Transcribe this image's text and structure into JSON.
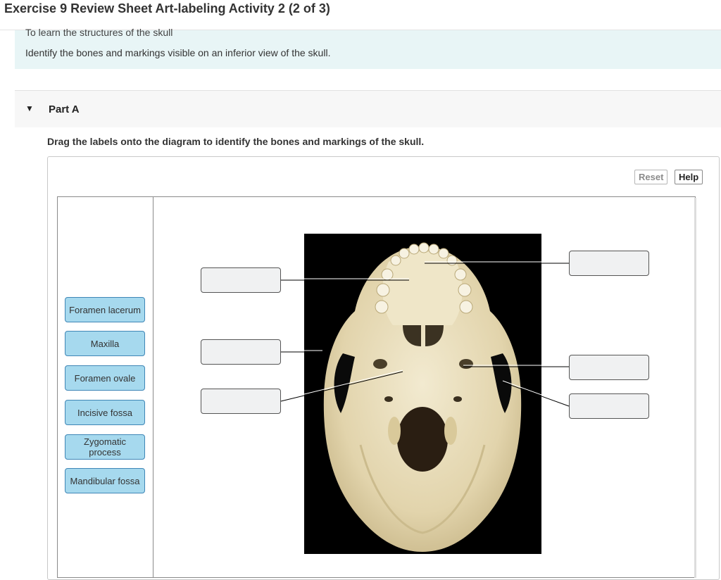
{
  "page": {
    "title": "Exercise 9 Review Sheet Art-labeling Activity 2 (2 of 3)"
  },
  "intro": {
    "objective": "To learn the structures of the skull",
    "text": "Identify the bones and markings visible on an inferior view of the skull."
  },
  "part": {
    "caret": "▼",
    "label": "Part A"
  },
  "instructions": "Drag the labels onto the diagram to identify the bones and markings of the skull.",
  "controls": {
    "reset": "Reset",
    "help": "Help"
  },
  "labels": [
    "Foramen lacerum",
    "Maxilla",
    "Foramen ovale",
    "Incisive fossa",
    "Zygomatic process",
    "Mandibular fossa"
  ],
  "colors": {
    "chip_fill": "#a6d9ee",
    "chip_border": "#3f86b6",
    "intro_bg": "#e8f5f6",
    "photo_bg": "#000000",
    "bone": "#eadfbf"
  }
}
